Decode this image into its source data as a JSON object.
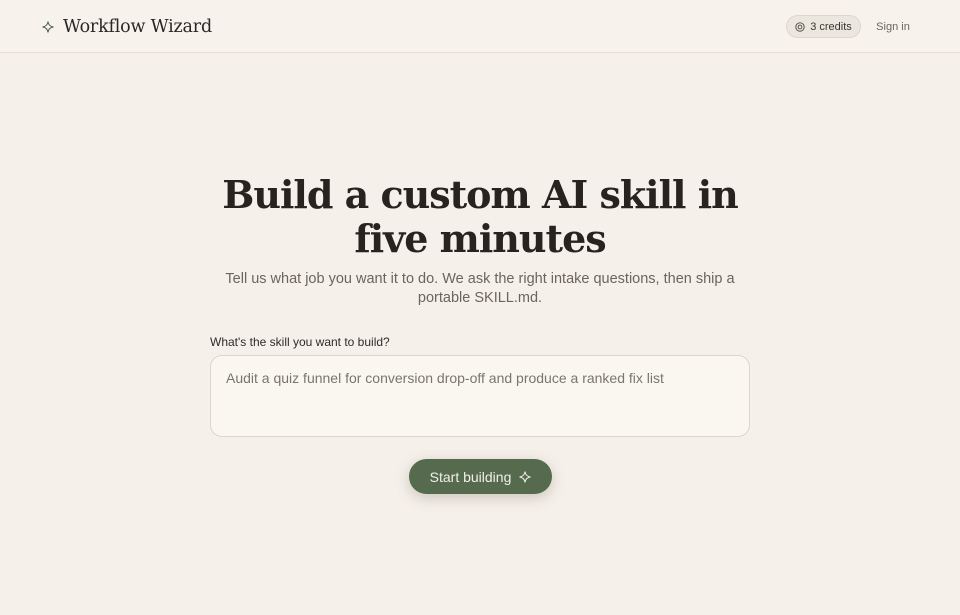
{
  "header": {
    "brand_icon": "sparkle-icon",
    "brand_name": "Workflow Wizard",
    "credits_icon": "coin-icon",
    "credits_label": "3 credits",
    "signin_label": "Sign in"
  },
  "hero": {
    "title": "Build a custom AI skill in five minutes",
    "subtitle": "Tell us what job you want it to do. We ask the right intake questions, then ship a portable SKILL.md."
  },
  "form": {
    "label": "What's the skill you want to build?",
    "value": "",
    "placeholder": "Audit a quiz funnel for conversion drop-off and produce a ranked fix list",
    "submit_label": "Start building",
    "submit_icon": "sparkle-icon"
  },
  "colors": {
    "background": "#f6f0ea",
    "accent": "#566b4e",
    "text": "#27231f",
    "muted": "#6a655e"
  }
}
